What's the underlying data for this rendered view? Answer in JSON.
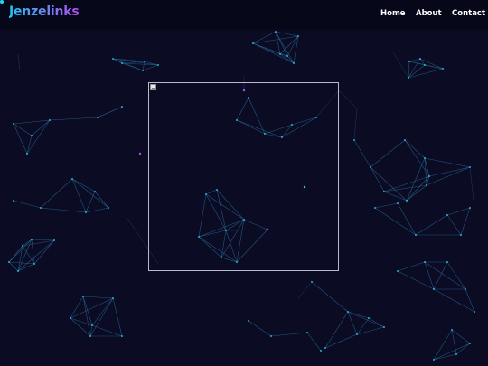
{
  "navbar": {
    "brand": "Jenzelinks",
    "links": [
      "Home",
      "About",
      "Contact"
    ]
  },
  "main": {
    "image_alt": "",
    "icon": "broken-image-icon"
  },
  "colors": {
    "background": "#0b0b24",
    "navbar": "#07071a",
    "brand_gradient_start": "#22c4f2",
    "brand_gradient_end": "#b14bf1",
    "network_line": "#2a6f9a",
    "network_node": "#2bd2f5",
    "frame_border": "#b9bad0"
  }
}
